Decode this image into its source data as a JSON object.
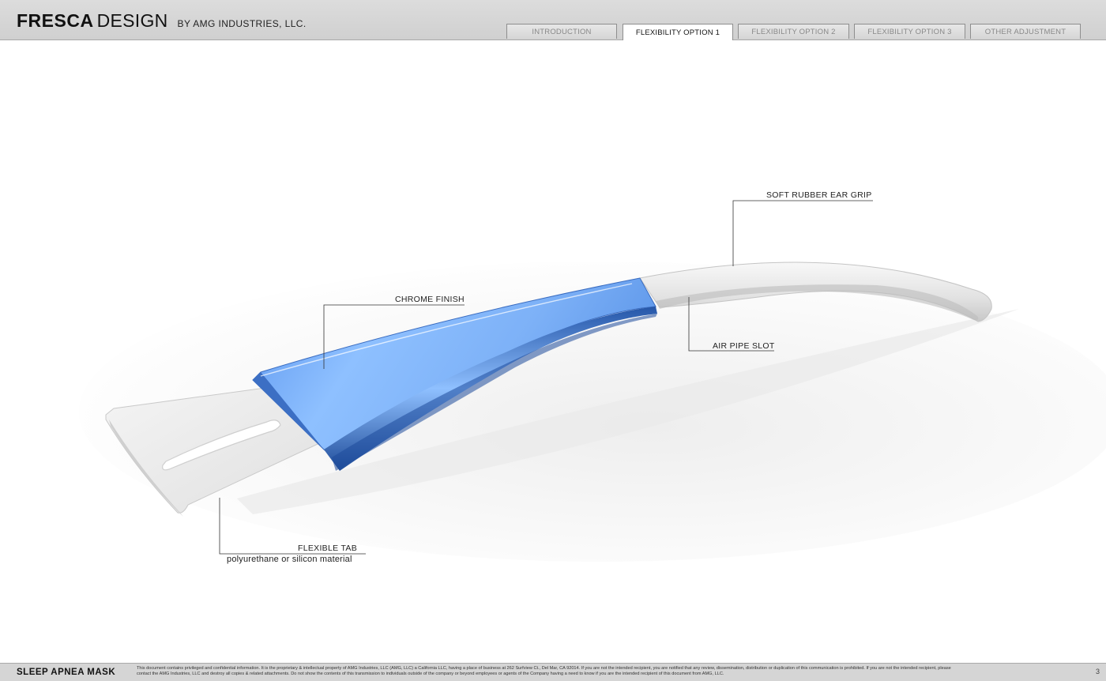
{
  "header": {
    "brand_bold": "FRESCA",
    "brand_light": "DESIGN",
    "brand_by": "BY AMG INDUSTRIES, LLC."
  },
  "tabs": [
    {
      "label": "INTRODUCTION",
      "active": false
    },
    {
      "label": "FLEXIBILITY OPTION 1",
      "active": true
    },
    {
      "label": "FLEXIBILITY OPTION 2",
      "active": false
    },
    {
      "label": "FLEXIBILITY OPTION 3",
      "active": false
    },
    {
      "label": "OTHER ADJUSTMENT",
      "active": false
    }
  ],
  "callouts": {
    "ear_grip": "SOFT RUBBER EAR GRIP",
    "chrome": "CHROME FINISH",
    "air_pipe": "AIR PIPE SLOT",
    "flex_tab": "FLEXIBLE TAB",
    "flex_tab_material": "polyurethane or silicon material"
  },
  "footer": {
    "title": "SLEEP APNEA MASK",
    "notice": "This document contains privileged and confidential information. It is the proprietary & intellectual property of AMG Industries, LLC (AMG, LLC) a California LLC, having a place of business at 262 Surfview Ct., Del Mar, CA 92014. If you are not the intended recipient, you are notified that any review, dissemination, distribution or duplication of this communication is prohibited. If you are not the intended recipient, please contact the AMG Industries, LLC and destroy all copies & related attachments. Do not show the contents of this transmission to individuals outside of the company or beyond employees or agents of the Company having a need to know if you are the intended recipient of this document from AMG, LLC.",
    "page_number": "3"
  },
  "colors": {
    "chrome_blue": "#6ea6f2",
    "chrome_dark": "#2f63b8",
    "rubber_grey": "#e4e4e4",
    "header_grey": "#d4d4d4"
  }
}
